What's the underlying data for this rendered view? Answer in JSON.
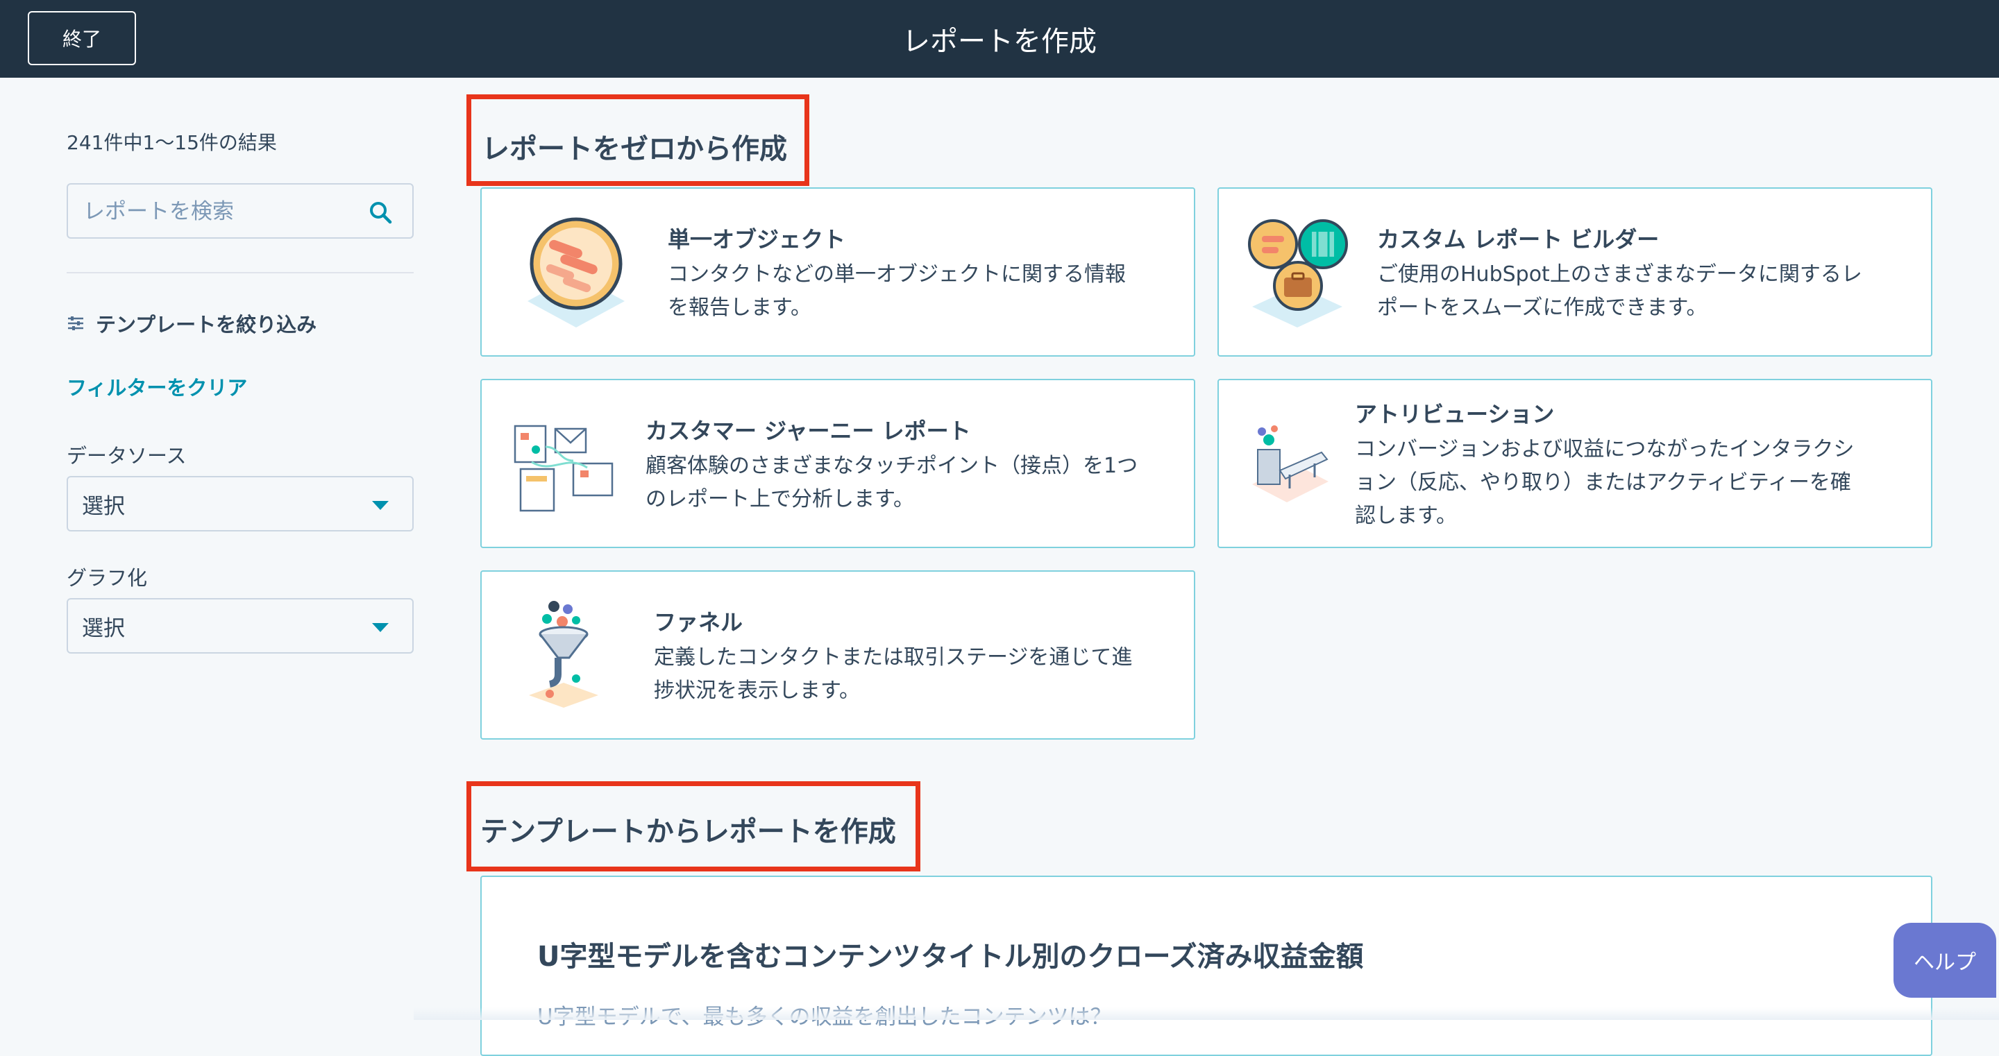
{
  "header": {
    "exit_label": "終了",
    "title": "レポートを作成"
  },
  "sidebar": {
    "results_count": "241件中1〜15件の結果",
    "search_placeholder": "レポートを検索",
    "filter_heading": "テンプレートを絞り込み",
    "clear_filters": "フィルターをクリア",
    "data_source": {
      "label": "データソース",
      "value": "選択"
    },
    "visualization": {
      "label": "グラフ化",
      "value": "選択"
    }
  },
  "scratch_section": {
    "title": "レポートをゼロから作成",
    "cards": [
      {
        "title": "単一オブジェクト",
        "desc_line1": "コンタクトなどの単一オブジェクトに関する情報",
        "desc_line2": "を報告します。",
        "icon": "single-object-illustration"
      },
      {
        "title": "カスタム レポート ビルダー",
        "desc_line1": "ご使用のHubSpot上のさまざまなデータに関するレ",
        "desc_line2": "ポートをスムーズに作成できます。",
        "icon": "custom-report-builder-illustration"
      },
      {
        "title": "カスタマー ジャーニー レポート",
        "desc_line1": "顧客体験のさまざまなタッチポイント（接点）を1つ",
        "desc_line2": "のレポート上で分析します。",
        "icon": "customer-journey-illustration"
      },
      {
        "title": "アトリビューション",
        "desc_line1": "コンバージョンおよび収益につながったインタラクシ",
        "desc_line2": "ョン（反応、やり取り）またはアクティビティーを確",
        "desc_line3": "認します。",
        "icon": "attribution-illustration"
      },
      {
        "title": "ファネル",
        "desc_line1": "定義したコンタクトまたは取引ステージを通じて進",
        "desc_line2": "捗状況を表示します。",
        "icon": "funnel-illustration"
      }
    ]
  },
  "template_section": {
    "title": "テンプレートからレポートを作成",
    "first_template": {
      "title": "U字型モデルを含むコンテンツタイトル別のクローズ済み収益金額",
      "desc": "U字型モデルで、最も多くの収益を創出したコンテンツは？"
    }
  },
  "help_label": "ヘルプ",
  "colors": {
    "header_bg": "#213343",
    "accent": "#0091ae",
    "card_border": "#7fd1de",
    "highlight_red": "#e8351b",
    "help_bg": "#6a78d1"
  }
}
